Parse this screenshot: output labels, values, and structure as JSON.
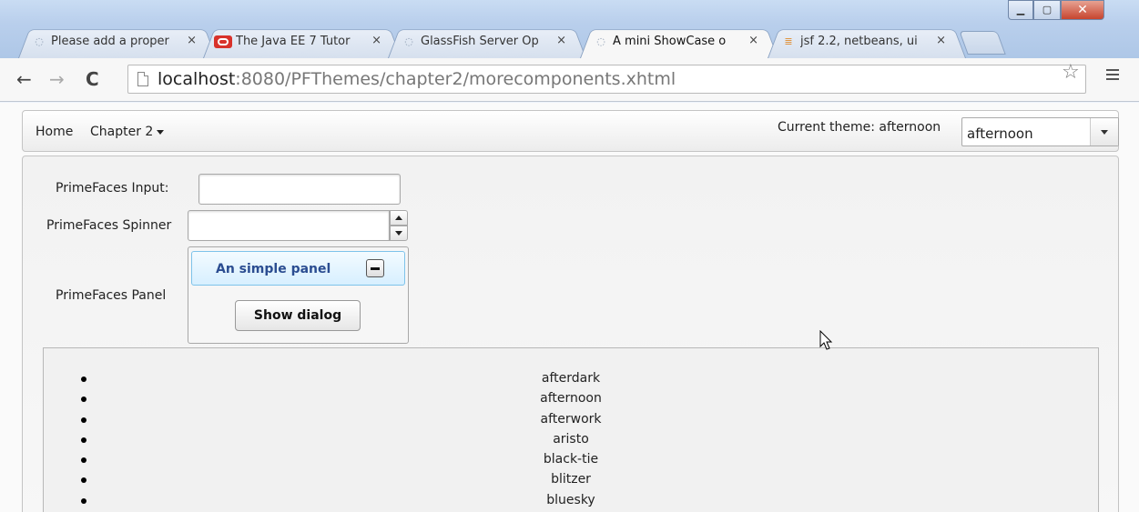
{
  "browser": {
    "tabs": [
      {
        "label": "Please add a proper",
        "icon": "page-loading-icon"
      },
      {
        "label": "The Java EE 7 Tutor",
        "icon": "oracle-icon"
      },
      {
        "label": "GlassFish Server Op",
        "icon": "page-loading-icon"
      },
      {
        "label": "A mini ShowCase o",
        "icon": "page-loading-icon",
        "active": true
      },
      {
        "label": "jsf 2.2, netbeans, ui",
        "icon": "stackoverflow-icon"
      }
    ],
    "close_glyph": "×",
    "url_host": "localhost",
    "url_rest": ":8080/PFThemes/chapter2/morecomponents.xhtml"
  },
  "menubar": {
    "home": "Home",
    "chapter": "Chapter 2",
    "theme_label": "Current theme: afternoon",
    "theme_value": "afternoon"
  },
  "form": {
    "input_label": "PrimeFaces Input:",
    "spinner_label": "PrimeFaces Spinner",
    "panel_label": "PrimeFaces Panel",
    "panel_title": "An simple panel",
    "show_dialog": "Show dialog"
  },
  "themes": [
    "afterdark",
    "afternoon",
    "afterwork",
    "aristo",
    "black-tie",
    "blitzer",
    "bluesky"
  ]
}
